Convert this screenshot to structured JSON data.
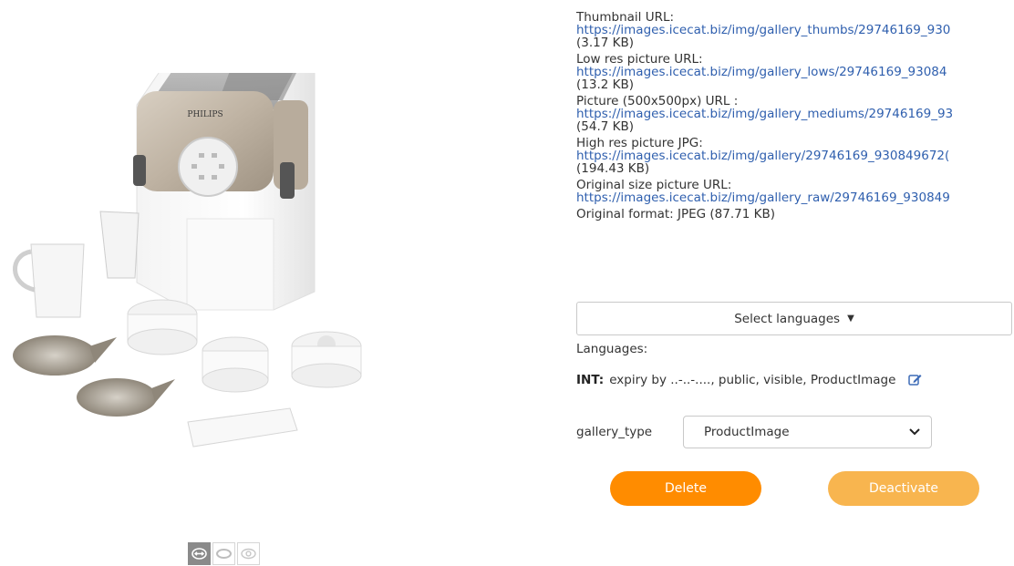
{
  "product_image": {
    "alt": "Philips pasta maker with accessories",
    "brand_text": "PHILIPS"
  },
  "thumbnails": [
    {
      "icon": "move-arrows-icon",
      "active": true
    },
    {
      "icon": "ring-icon",
      "active": false
    },
    {
      "icon": "eye-icon",
      "active": false
    }
  ],
  "info": {
    "thumbnail": {
      "label": "Thumbnail URL:",
      "url": "https://images.icecat.biz/img/gallery_thumbs/29746169_930",
      "size": "(3.17 KB)"
    },
    "lowres": {
      "label": "Low res picture URL:",
      "url": "https://images.icecat.biz/img/gallery_lows/29746169_93084",
      "size": "(13.2 KB)"
    },
    "medium": {
      "label": "Picture (500x500px) URL :",
      "url": "https://images.icecat.biz/img/gallery_mediums/29746169_93",
      "size": "(54.7 KB)"
    },
    "highres": {
      "label": "High res picture JPG:",
      "url": "https://images.icecat.biz/img/gallery/29746169_930849672(",
      "size": "(194.43 KB)"
    },
    "original": {
      "label": "Original size picture URL:",
      "url": "https://images.icecat.biz/img/gallery_raw/29746169_930849"
    },
    "original_format": "Original format: JPEG (87.71 KB)"
  },
  "select_languages_label": "Select languages",
  "languages_label": "Languages:",
  "lang_entry": {
    "code": "INT:",
    "text": "expiry by ..-..-...., public, visible, ProductImage"
  },
  "gallery": {
    "label": "gallery_type",
    "selected": "ProductImage"
  },
  "buttons": {
    "delete": "Delete",
    "deactivate": "Deactivate"
  },
  "colors": {
    "link": "#2f5fae",
    "delete": "#ff8c00",
    "deactivate": "#f8b54f"
  }
}
